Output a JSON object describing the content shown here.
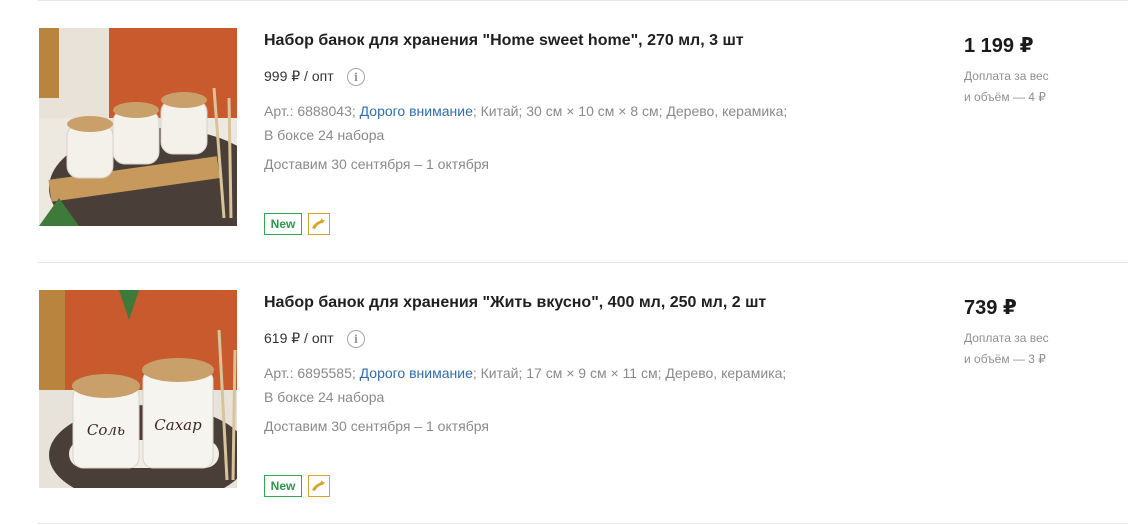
{
  "products": [
    {
      "title": "Набор банок для хранения \"Home sweet home\", 270 мл, 3 шт",
      "wholesale_price": "999 ₽ / опт",
      "article": "Арт.: 6888043;",
      "brand": "Дорого внимание",
      "specs_rest": "; Китай; 30 см × 10 см × 8 см; Дерево, керамика;",
      "box": "В боксе 24 набора",
      "delivery": "Доставим 30 сентября – 1 октября",
      "badge": "New",
      "price": "1 199 ₽",
      "surcharge_line1": "Доплата за вес",
      "surcharge_line2": "и объём — 4 ₽"
    },
    {
      "title": "Набор банок для хранения \"Жить вкусно\", 400 мл, 250 мл, 2 шт",
      "wholesale_price": "619 ₽ / опт",
      "article": "Арт.: 6895585;",
      "brand": "Дорого внимание",
      "specs_rest": "; Китай; 17 см × 9 см × 11 см; Дерево, керамика;",
      "box": "В боксе 24 набора",
      "delivery": "Доставим 30 сентября – 1 октября",
      "badge": "New",
      "price": "739 ₽",
      "surcharge_line1": "Доплата за вес",
      "surcharge_line2": "и объём — 3 ₽",
      "jar_labels": [
        "Соль",
        "Сахар"
      ]
    }
  ],
  "icons": {
    "info": "i",
    "brand_badge": "dolphin-icon"
  },
  "colors": {
    "link": "#2f6db5",
    "badge_new": "#31a854",
    "badge_brand": "#d9a42a"
  }
}
